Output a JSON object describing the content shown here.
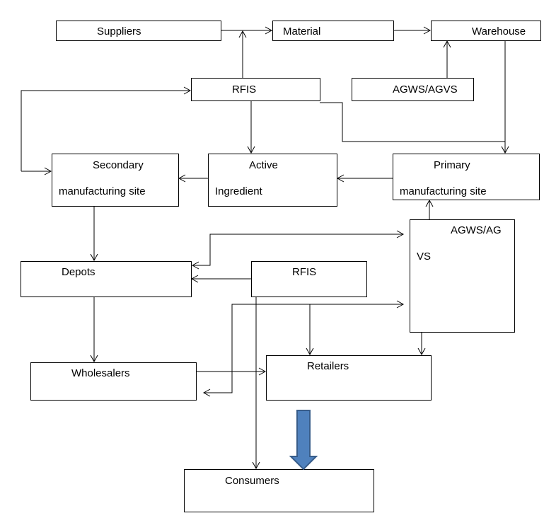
{
  "nodes": {
    "suppliers": "Suppliers",
    "material": "Material",
    "warehouse": "Warehouse",
    "rfis_top": "RFIS",
    "agws_agvs": "AGWS/AGVS",
    "secondary_1": "Secondary",
    "secondary_2": "manufacturing site",
    "active_1": "Active",
    "active_2": "Ingredient",
    "primary_1": "Primary",
    "primary_2": "manufacturing site",
    "agws_ag_1": "AGWS/AG",
    "agws_ag_2": "VS",
    "depots": "Depots",
    "rfis_mid": "RFIS",
    "wholesalers": "Wholesalers",
    "retailers": "Retailers",
    "consumers": "Consumers"
  },
  "colors": {
    "block_arrow": "#4f81bd",
    "block_arrow_stroke": "#385d8a"
  }
}
